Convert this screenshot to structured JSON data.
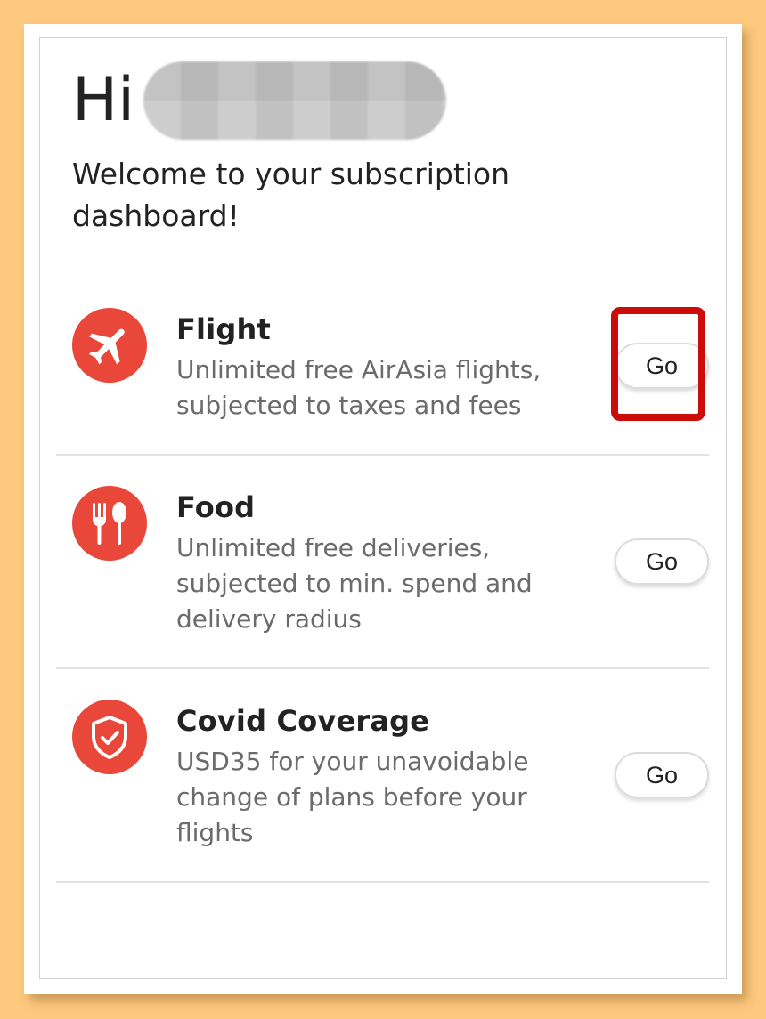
{
  "header": {
    "greeting": "Hi",
    "welcome_text": "Welcome to your subscription dashboard!"
  },
  "subscriptions": [
    {
      "title": "Flight",
      "description": "Unlimited free AirAsia flights, subjected to taxes and fees",
      "icon": "airplane-icon",
      "button_label": "Go"
    },
    {
      "title": "Food",
      "description": "Unlimited free deliveries, subjected to min. spend and delivery radius",
      "icon": "fork-spoon-icon",
      "button_label": "Go"
    },
    {
      "title": "Covid Coverage",
      "description": "USD35 for your unavoidable change of plans before your flights",
      "icon": "shield-check-icon",
      "button_label": "Go"
    }
  ],
  "colors": {
    "background": "#FCC97E",
    "icon_red": "#E8473A",
    "highlight_red": "#CC0B0B",
    "text_dark": "#222222",
    "text_muted": "#6b6b6b"
  }
}
